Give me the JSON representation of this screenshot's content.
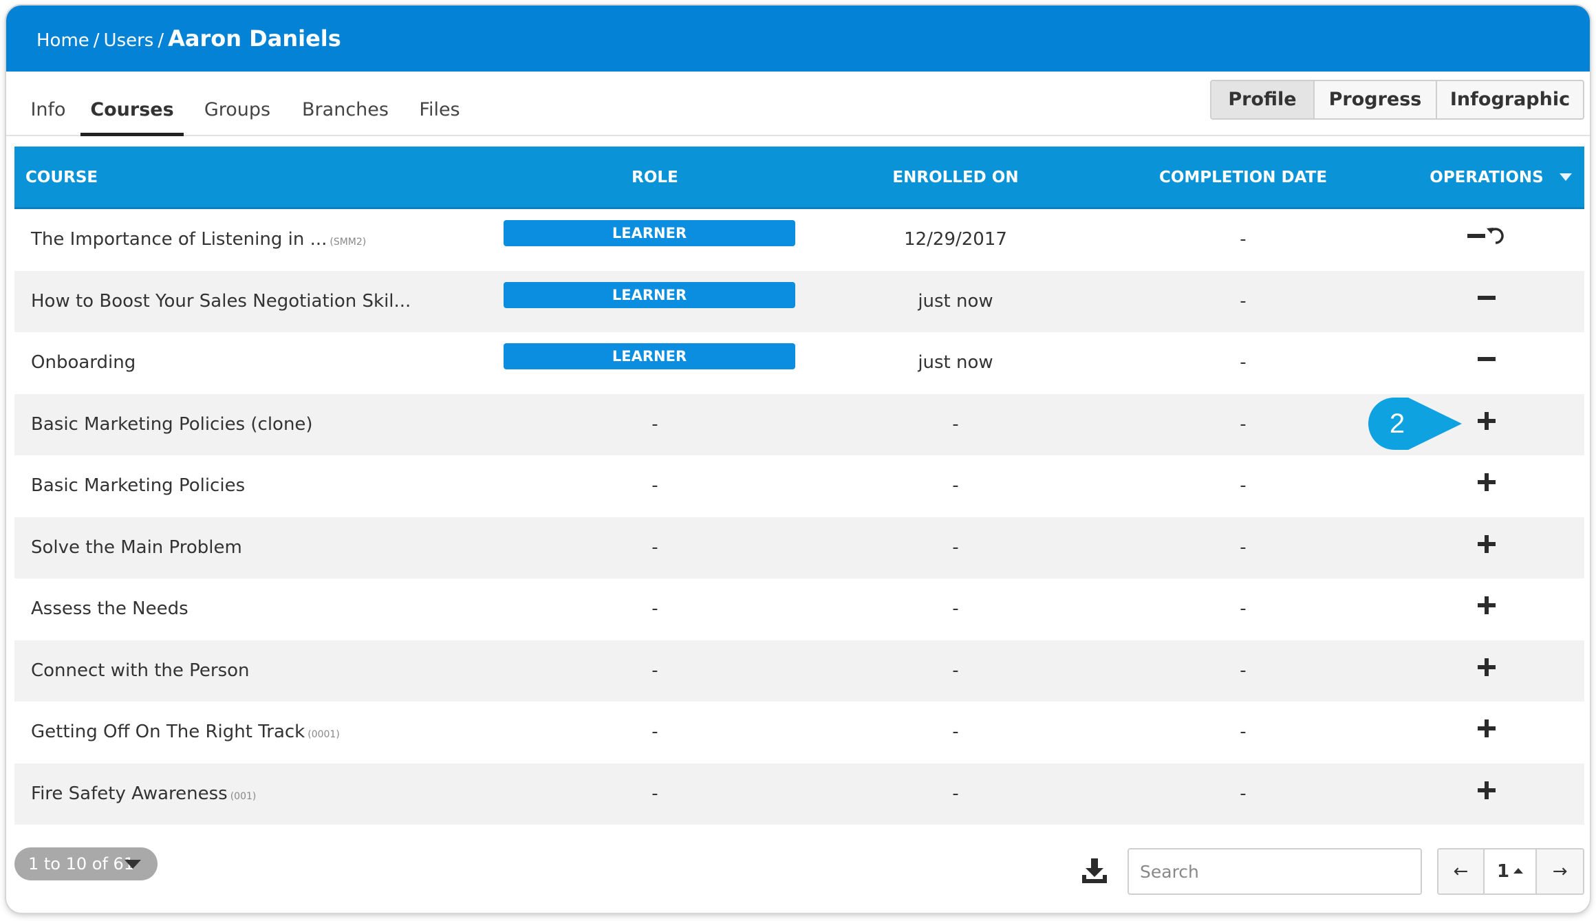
{
  "breadcrumb": {
    "home": "Home",
    "sep1": "/",
    "users": "Users",
    "sep2": "/",
    "current": "Aaron Daniels"
  },
  "tabs": [
    {
      "label": "Info",
      "active": false
    },
    {
      "label": "Courses",
      "active": true
    },
    {
      "label": "Groups",
      "active": false
    },
    {
      "label": "Branches",
      "active": false
    },
    {
      "label": "Files",
      "active": false
    }
  ],
  "view_toggle": {
    "profile": "Profile",
    "progress": "Progress",
    "infographic": "Infographic"
  },
  "table": {
    "headers": {
      "course": "COURSE",
      "role": "ROLE",
      "enrolled_on": "ENROLLED ON",
      "completion_date": "COMPLETION DATE",
      "operations": "OPERATIONS"
    },
    "rows": [
      {
        "course": "The Importance of Listening in ...",
        "code": "(SMM2)",
        "role": "LEARNER",
        "enrolled_on": "12/29/2017",
        "completion_date": "-",
        "operations": [
          "minus-icon",
          "reset-icon"
        ]
      },
      {
        "course": "How to Boost Your Sales Negotiation Skil...",
        "code": "",
        "role": "LEARNER",
        "enrolled_on": "just now",
        "completion_date": "-",
        "operations": [
          "minus-icon"
        ]
      },
      {
        "course": "Onboarding",
        "code": "",
        "role": "LEARNER",
        "enrolled_on": "just now",
        "completion_date": "-",
        "operations": [
          "minus-icon"
        ]
      },
      {
        "course": "Basic Marketing Policies (clone)",
        "code": "",
        "role": "-",
        "enrolled_on": "-",
        "completion_date": "-",
        "operations": [
          "plus-icon"
        ]
      },
      {
        "course": "Basic Marketing Policies",
        "code": "",
        "role": "-",
        "enrolled_on": "-",
        "completion_date": "-",
        "operations": [
          "plus-icon"
        ]
      },
      {
        "course": "Solve the Main Problem",
        "code": "",
        "role": "-",
        "enrolled_on": "-",
        "completion_date": "-",
        "operations": [
          "plus-icon"
        ]
      },
      {
        "course": "Assess the Needs",
        "code": "",
        "role": "-",
        "enrolled_on": "-",
        "completion_date": "-",
        "operations": [
          "plus-icon"
        ]
      },
      {
        "course": "Connect with the Person",
        "code": "",
        "role": "-",
        "enrolled_on": "-",
        "completion_date": "-",
        "operations": [
          "plus-icon"
        ]
      },
      {
        "course": "Getting Off On The Right Track",
        "code": "(0001)",
        "role": "-",
        "enrolled_on": "-",
        "completion_date": "-",
        "operations": [
          "plus-icon"
        ]
      },
      {
        "course": "Fire Safety Awareness",
        "code": "(001)",
        "role": "-",
        "enrolled_on": "-",
        "completion_date": "-",
        "operations": [
          "plus-icon"
        ]
      }
    ]
  },
  "callout": {
    "number": "2"
  },
  "footer": {
    "range": "1 to 10 of 61",
    "search_placeholder": "Search",
    "prev": "←",
    "page": "1",
    "next": "→"
  },
  "colors": {
    "topbar": "#0483d6",
    "table_header": "#0b93d8",
    "badge": "#0b8de0",
    "callout": "#0ea2e0"
  }
}
